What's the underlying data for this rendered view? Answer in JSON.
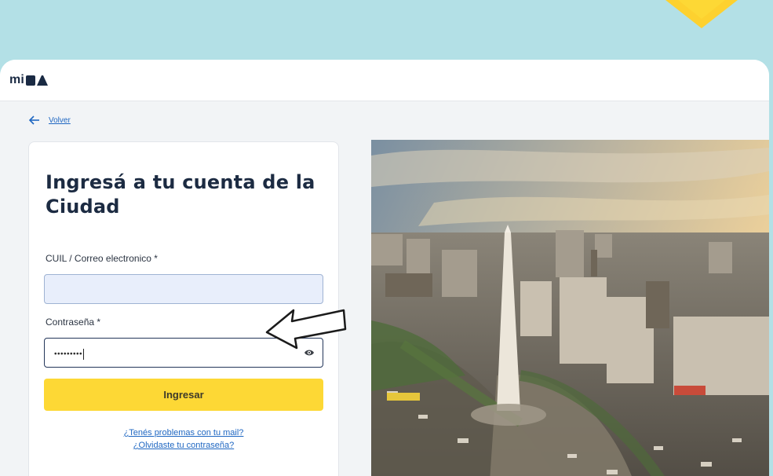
{
  "header": {
    "logo_text": "mi",
    "logo_mark_text": "BA"
  },
  "nav": {
    "back_label": "Volver"
  },
  "login": {
    "title": "Ingresá a tu cuenta de la Ciudad",
    "user_label": "CUIL / Correo electronico *",
    "user_value": "",
    "password_label": "Contraseña *",
    "password_value": "•••••••••",
    "submit_label": "Ingresar",
    "help_mail": "¿Tenés problemas con tu mail?",
    "help_password": "¿Olvidaste tu contraseña?"
  },
  "icons": {
    "back": "arrow-left-icon",
    "eye": "eye-icon",
    "pointer": "hand-drawn-arrow-icon"
  },
  "colors": {
    "background": "#b3e0e6",
    "accent_yellow": "#fdd835",
    "navy": "#1c2b42",
    "link_blue": "#1f67c2"
  }
}
